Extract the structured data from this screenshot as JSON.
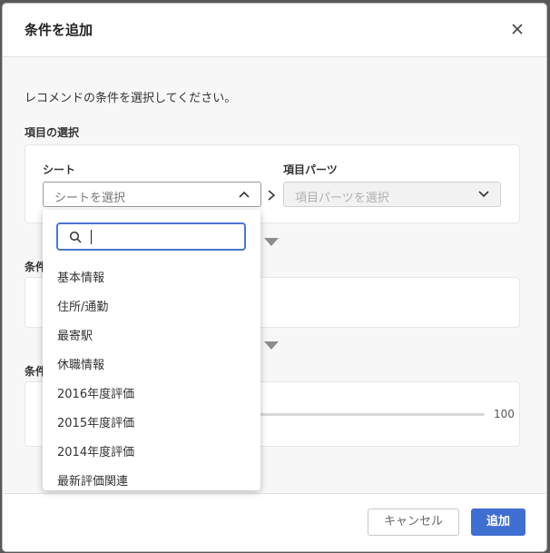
{
  "modal": {
    "title": "条件を追加",
    "intro": "レコメンドの条件を選択してください。",
    "section_item_select": "項目の選択",
    "section_2_partial": "条件",
    "section_3_partial": "条件"
  },
  "item_select": {
    "sheet_label": "シート",
    "sheet_placeholder": "シートを選択",
    "parts_label": "項目パーツ",
    "parts_placeholder": "項目パーツを選択"
  },
  "slider": {
    "max_label": "100",
    "value_fraction": 0.36,
    "accent": "#3f6fd0"
  },
  "dropdown": {
    "search_value": "",
    "items": [
      "基本情報",
      "住所/通勤",
      "最寄駅",
      "休職情報",
      "2016年度評価",
      "2015年度評価",
      "2014年度評価",
      "最新評価関連"
    ]
  },
  "footer": {
    "cancel_label": "キャンセル",
    "add_label": "追加"
  },
  "icons": {
    "close": "close-icon",
    "search": "search-icon",
    "chevron_up": "chevron-up-icon",
    "chevron_down": "chevron-down-icon",
    "arrow_right": "chevron-right-icon"
  },
  "colors": {
    "accent": "#3f6fd0",
    "focus_border": "#4a77d2"
  }
}
